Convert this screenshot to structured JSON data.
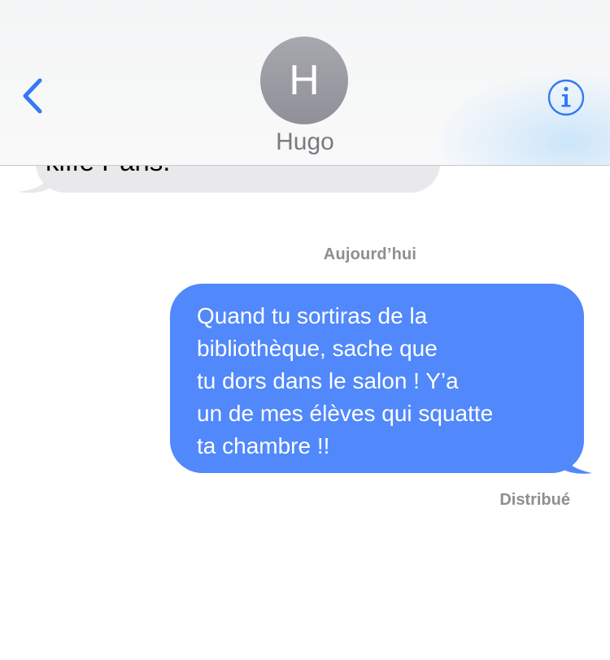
{
  "header": {
    "back_icon": "chevron-left-icon",
    "contact_initial": "H",
    "contact_name": "Hugo",
    "info_icon": "info-circle-icon",
    "accent_color": "#3478f6"
  },
  "thread": {
    "incoming_partial_text": "kiffe Paris.",
    "date_separator": "Aujourd’hui",
    "outgoing_message_lines": [
      "Quand tu sortiras de la",
      "bibliothèque, sache que",
      "tu dors dans le salon ! Y’a",
      "un de mes élèves qui squatte",
      "ta chambre !!"
    ],
    "outgoing_bubble_color": "#5188fb",
    "incoming_bubble_color": "#e9e9eb",
    "delivery_status": "Distribué"
  }
}
